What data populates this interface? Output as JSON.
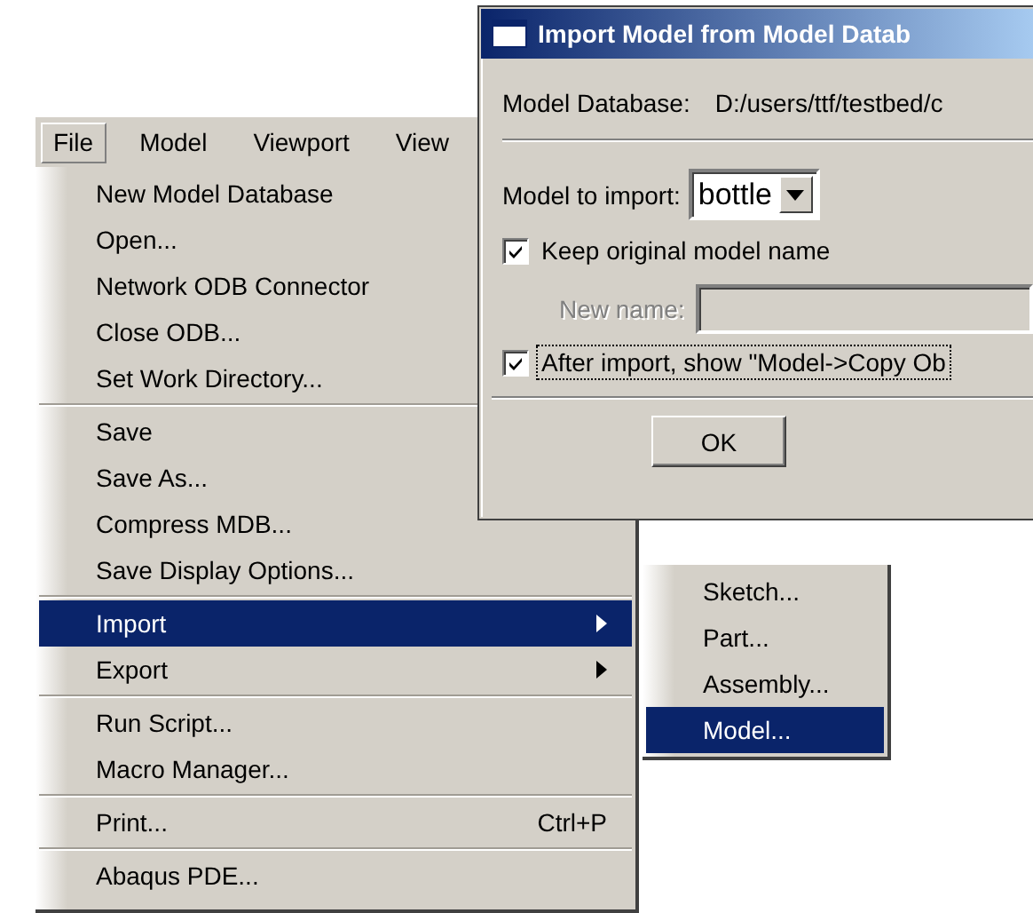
{
  "menubar": [
    {
      "label": "File",
      "selected": true
    },
    {
      "label": "Model",
      "selected": false
    },
    {
      "label": "Viewport",
      "selected": false
    },
    {
      "label": "View",
      "selected": false
    }
  ],
  "file_menu": {
    "groups": [
      [
        {
          "label": "New Model Database",
          "kind": "item",
          "selected": false
        },
        {
          "label": "Open...",
          "kind": "item",
          "selected": false
        },
        {
          "label": "Network ODB Connector",
          "kind": "item",
          "selected": false
        },
        {
          "label": "Close ODB...",
          "kind": "item",
          "selected": false
        },
        {
          "label": "Set Work Directory...",
          "kind": "item",
          "selected": false
        }
      ],
      [
        {
          "label": "Save",
          "kind": "item",
          "selected": false
        },
        {
          "label": "Save As...",
          "kind": "item",
          "selected": false
        },
        {
          "label": "Compress MDB...",
          "kind": "item",
          "selected": false
        },
        {
          "label": "Save Display Options...",
          "kind": "item",
          "selected": false
        }
      ],
      [
        {
          "label": "Import",
          "kind": "submenu",
          "selected": true
        },
        {
          "label": "Export",
          "kind": "submenu",
          "selected": false
        }
      ],
      [
        {
          "label": "Run Script...",
          "kind": "item",
          "selected": false
        },
        {
          "label": "Macro Manager...",
          "kind": "item",
          "selected": false
        }
      ],
      [
        {
          "label": "Print...",
          "kind": "item",
          "selected": false,
          "shortcut": "Ctrl+P"
        }
      ],
      [
        {
          "label": "Abaqus PDE...",
          "kind": "item",
          "selected": false
        }
      ]
    ]
  },
  "import_submenu": {
    "groups": [
      [
        {
          "label": "Sketch...",
          "kind": "item",
          "selected": false
        },
        {
          "label": "Part...",
          "kind": "item",
          "selected": false
        },
        {
          "label": "Assembly...",
          "kind": "item",
          "selected": false
        },
        {
          "label": "Model...",
          "kind": "item",
          "selected": true
        }
      ]
    ]
  },
  "dialog": {
    "title": "Import Model from Model Datab",
    "database_label": "Model Database:",
    "database_path": "D:/users/ttf/testbed/c",
    "model_label": "Model to import:",
    "model_value": "bottle",
    "keep_name": {
      "label": "Keep original model name",
      "checked": true
    },
    "new_name": {
      "label": "New name:",
      "disabled": true
    },
    "after_import": {
      "label": "After import, show \"Model->Copy Ob",
      "checked": true,
      "focused": true
    },
    "ok": "OK"
  }
}
